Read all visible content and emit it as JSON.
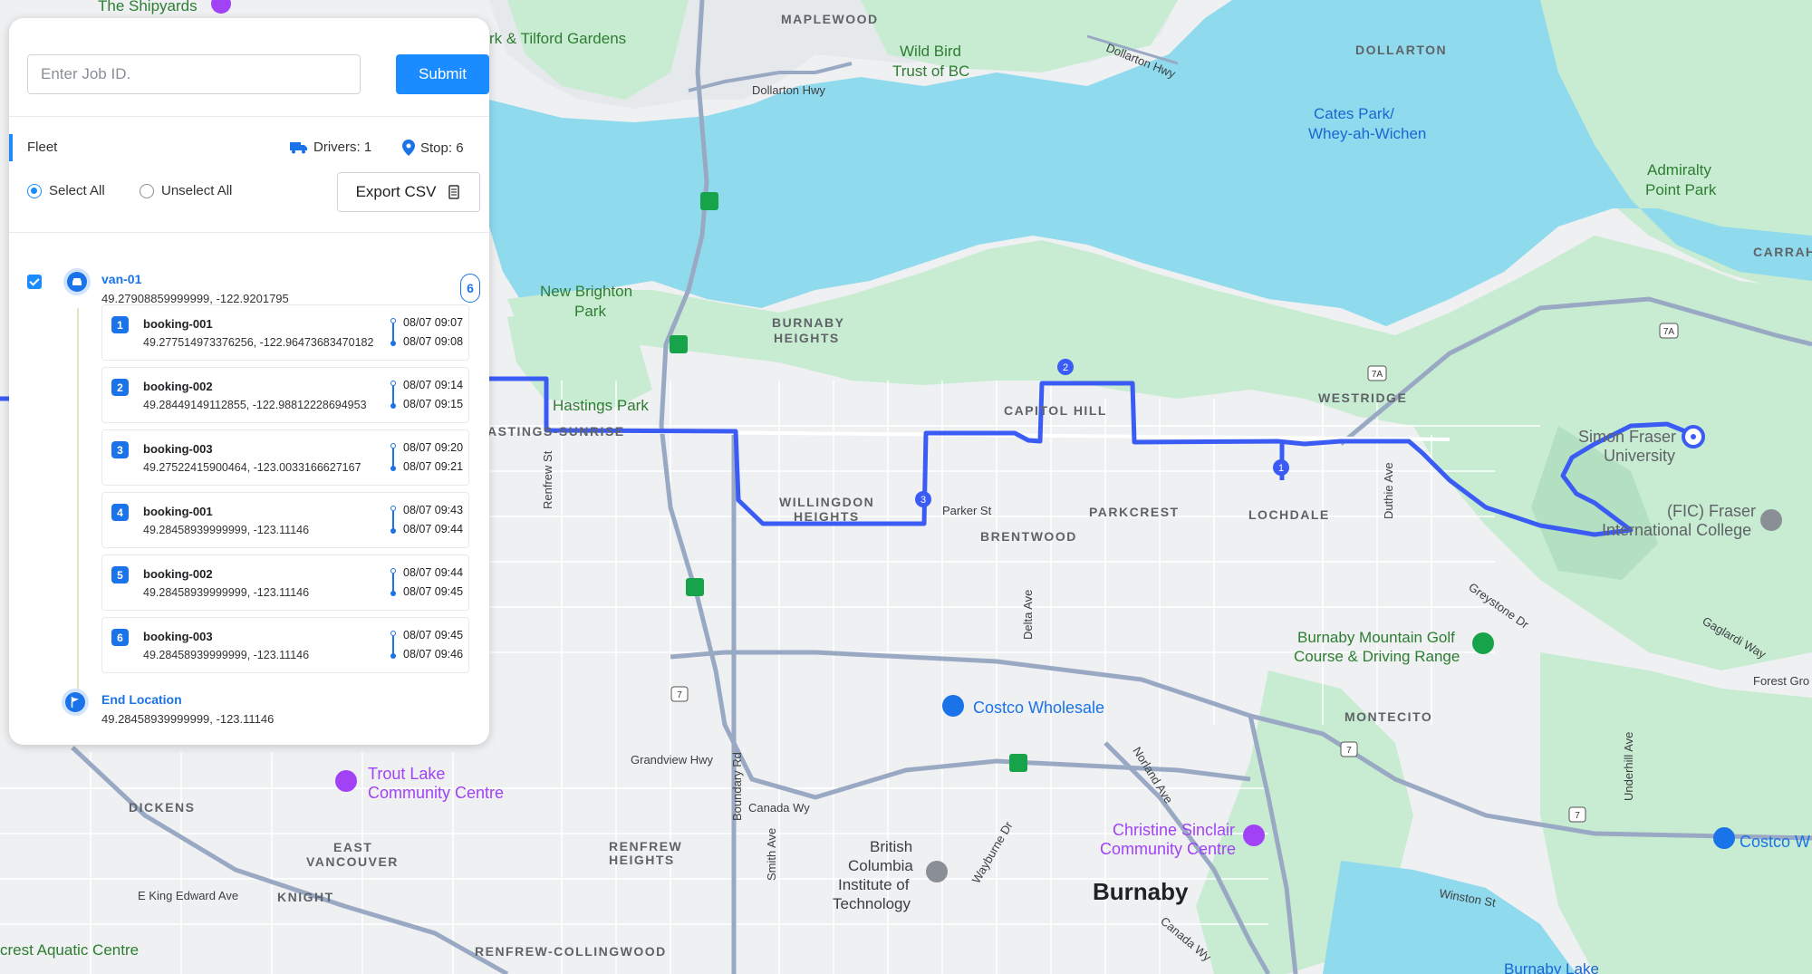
{
  "panel": {
    "job_input_placeholder": "Enter Job ID.",
    "submit_label": "Submit",
    "fleet_label": "Fleet",
    "drivers_label": "Drivers: 1",
    "stops_label": "Stop: 6",
    "select_all_label": "Select All",
    "unselect_all_label": "Unselect All",
    "export_label": "Export CSV",
    "driver": {
      "name": "van-01",
      "coords": "49.27908859999999, -122.9201795",
      "stop_count": "6"
    },
    "stops": [
      {
        "num": "1",
        "name": "booking-001",
        "coords": "49.277514973376256, -122.96473683470182",
        "time_start": "08/07 09:07",
        "time_end": "08/07 09:08"
      },
      {
        "num": "2",
        "name": "booking-002",
        "coords": "49.28449149112855, -122.98812228694953",
        "time_start": "08/07 09:14",
        "time_end": "08/07 09:15"
      },
      {
        "num": "3",
        "name": "booking-003",
        "coords": "49.27522415900464, -123.0033166627167",
        "time_start": "08/07 09:20",
        "time_end": "08/07 09:21"
      },
      {
        "num": "4",
        "name": "booking-001",
        "coords": "49.28458939999999, -123.11146",
        "time_start": "08/07 09:43",
        "time_end": "08/07 09:44"
      },
      {
        "num": "5",
        "name": "booking-002",
        "coords": "49.28458939999999, -123.11146",
        "time_start": "08/07 09:44",
        "time_end": "08/07 09:45"
      },
      {
        "num": "6",
        "name": "booking-003",
        "coords": "49.28458939999999, -123.11146",
        "time_start": "08/07 09:45",
        "time_end": "08/07 09:46"
      }
    ],
    "end_location": {
      "title": "End Location",
      "coords": "49.28458939999999, -123.11146"
    }
  },
  "map": {
    "colors": {
      "water": "#90daee",
      "park": "#c8ecd2",
      "land": "#eef0f2",
      "route": "#3a5cf5",
      "major_road": "#9aa9c3"
    },
    "labels": {
      "shipyards": "The Shipyards",
      "maplewood": "MAPLEWOOD",
      "dollarton": "DOLLARTON",
      "tilford": "rk & Tilford Gardens",
      "wild_bird_1": "Wild Bird",
      "wild_bird_2": "Trust of BC",
      "dollarton_hwy_1": "Dollarton Hwy",
      "dollarton_hwy_2": "Dollarton Hwy",
      "cates_1": "Cates Park/",
      "cates_2": "Whey-ah-Wichen",
      "admiralty_1": "Admiralty",
      "admiralty_2": "Point Park",
      "carraholly": "CARRAHOLL",
      "new_brighton_1": "New Brighton",
      "new_brighton_2": "Park",
      "burnaby_heights_1": "BURNABY",
      "burnaby_heights_2": "HEIGHTS",
      "hastings_park": "Hastings Park",
      "hastings_sunrise": "ASTINGS-SUNRISE",
      "capitol_hill": "CAPITOL HILL",
      "westridge": "WESTRIDGE",
      "sfu_1": "Simon Fraser",
      "sfu_2": "University",
      "fic_1": "(FIC) Fraser",
      "fic_2": "International College",
      "willingdon_1": "WILLINGDON",
      "willingdon_2": "HEIGHTS",
      "parker_st": "Parker St",
      "parkcrest": "PARKCREST",
      "brentwood": "BRENTWOOD",
      "lochdale": "LOCHDALE",
      "renfrew_st": "Renfrew St",
      "duthie_ave": "Duthie Ave",
      "delta_ave": "Delta Ave",
      "greystone": "Greystone Dr",
      "gaglardi": "Gaglardi Way",
      "forest_grove": "Forest Gro",
      "golf_1": "Burnaby Mountain Golf",
      "golf_2": "Course & Driving Range",
      "costco": "Costco Wholesale",
      "costco_2": "Costco W",
      "montecito": "MONTECITO",
      "grandview": "Grandview Hwy",
      "boundary": "Boundary Rd",
      "noriand": "Norland Ave",
      "underhill": "Underhill Ave",
      "trout_1": "Trout Lake",
      "trout_2": "Community Centre",
      "dickens": "DICKENS",
      "east_van_1": "EAST",
      "east_van_2": "VANCOUVER",
      "canada_wy": "Canada Wy",
      "smith_ave": "Smith Ave",
      "renfrew_h_1": "RENFREW",
      "renfrew_h_2": "HEIGHTS",
      "bcit_1": "British",
      "bcit_2": "Columbia",
      "bcit_3": "Institute of",
      "bcit_4": "Technology",
      "waybourne": "Wayburne Dr",
      "christine_1": "Christine Sinclair",
      "christine_2": "Community Centre",
      "burnaby": "Burnaby",
      "winston": "Winston St",
      "canada_way_2": "Canada Wy",
      "e_king_edward": "E King Edward Ave",
      "knight": "KNIGHT",
      "crest_aquatic": "crest Aquatic Centre",
      "renfrew_collingwood": "RENFREW-COLLINGWOOD",
      "burnaby_lake": "Burnaby Lake",
      "hwy_7a_1": "7A",
      "hwy_7a_2": "7A",
      "hwy_7_1": "7",
      "hwy_7_2": "7",
      "hwy_7_3": "7",
      "marker_1": "1",
      "marker_2": "2",
      "marker_3": "3"
    }
  }
}
